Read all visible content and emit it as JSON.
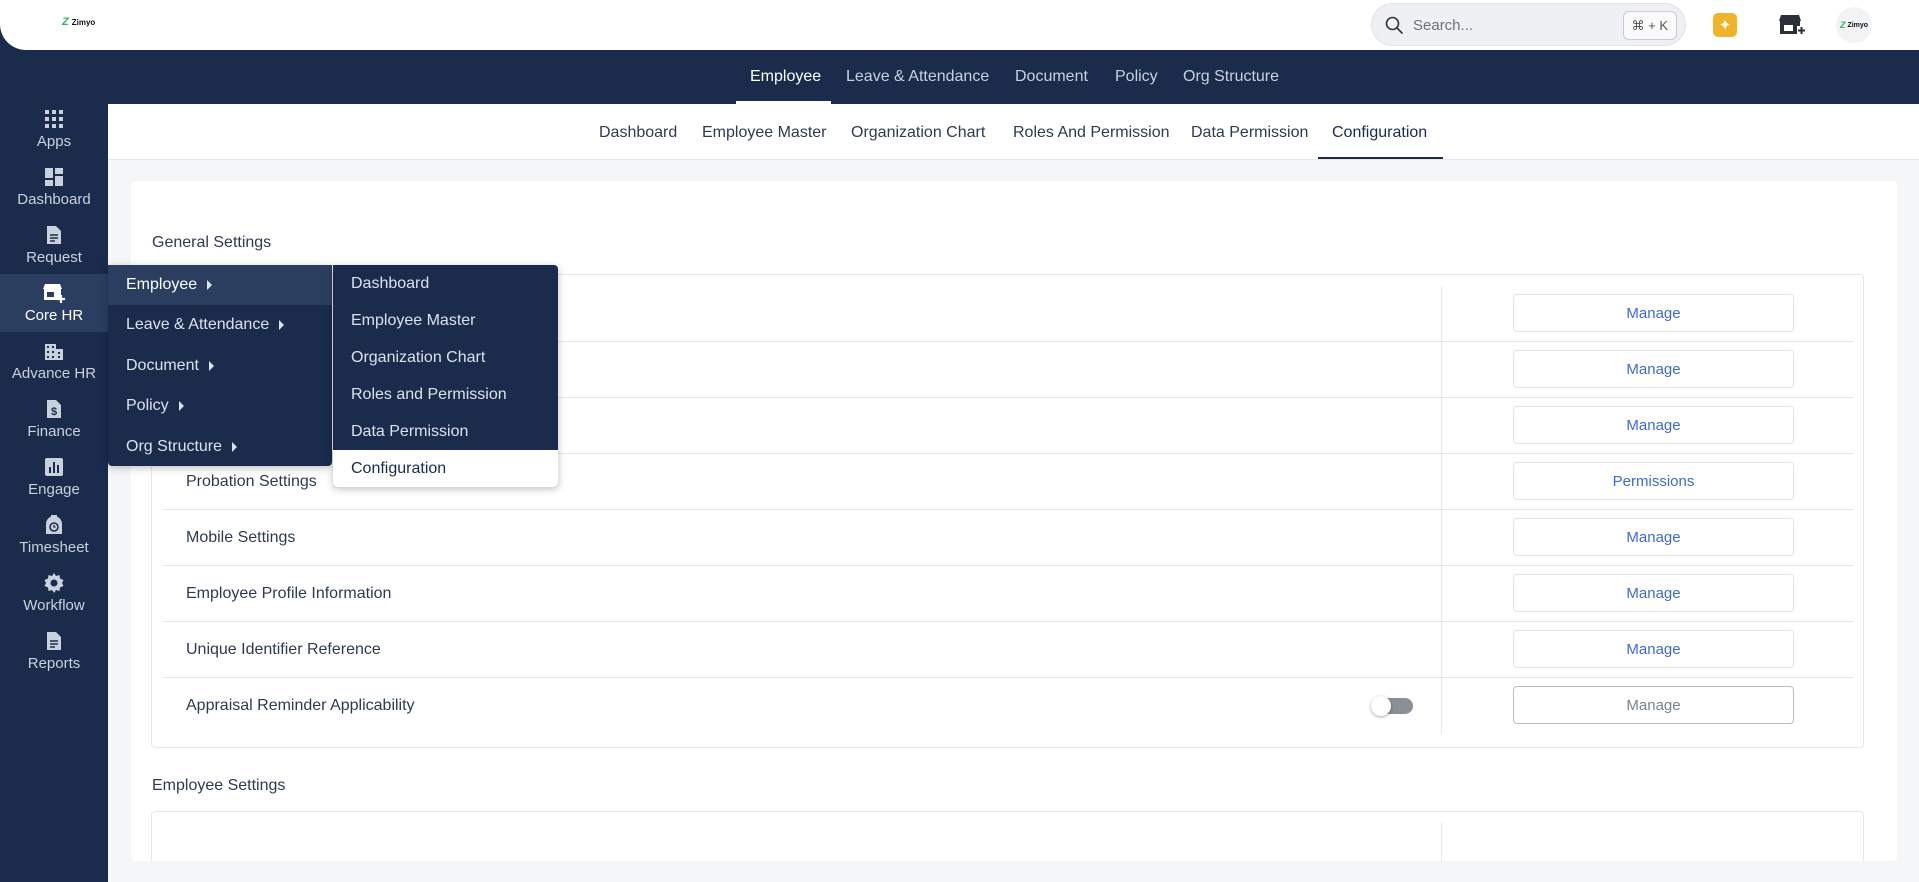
{
  "brand": {
    "logo_mark": "Z",
    "logo_text": "Zimyo"
  },
  "topbar": {
    "search_placeholder": "Search...",
    "search_shortcut": "⌘ + K",
    "icons": [
      "search-icon",
      "sparkle-icon",
      "store-add-icon",
      "avatar"
    ]
  },
  "module_nav": {
    "items": [
      "Employee",
      "Leave & Attendance",
      "Document",
      "Policy",
      "Org Structure"
    ],
    "active": "Employee"
  },
  "sidebar": {
    "items": [
      {
        "label": "Apps",
        "icon": "apps-grid-icon"
      },
      {
        "label": "Dashboard",
        "icon": "dashboard-icon"
      },
      {
        "label": "Request",
        "icon": "document-icon"
      },
      {
        "label": "Core HR",
        "icon": "store-add-icon"
      },
      {
        "label": "Advance HR",
        "icon": "building-icon"
      },
      {
        "label": "Finance",
        "icon": "dollar-doc-icon"
      },
      {
        "label": "Engage",
        "icon": "bar-chart-icon"
      },
      {
        "label": "Timesheet",
        "icon": "timer-icon"
      },
      {
        "label": "Workflow",
        "icon": "gear-icon"
      },
      {
        "label": "Reports",
        "icon": "report-icon"
      }
    ],
    "active": "Core HR"
  },
  "sub_nav": {
    "items": [
      "Dashboard",
      "Employee Master",
      "Organization Chart",
      "Roles And Permission",
      "Data Permission",
      "Configuration"
    ],
    "active": "Configuration"
  },
  "general_settings": {
    "title": "General Settings",
    "rows": [
      {
        "label": "",
        "action": "Manage"
      },
      {
        "label": "",
        "action": "Manage"
      },
      {
        "label": "",
        "action": "Manage"
      },
      {
        "label": "Probation Settings",
        "action": "Permissions"
      },
      {
        "label": "Mobile Settings",
        "action": "Manage"
      },
      {
        "label": "Employee Profile Information",
        "action": "Manage"
      },
      {
        "label": "Unique Identifier Reference",
        "action": "Manage"
      },
      {
        "label": "Appraisal Reminder Applicability",
        "action": "Manage",
        "toggle": "off"
      }
    ]
  },
  "employee_settings": {
    "title": "Employee Settings"
  },
  "flyout_menu": {
    "level1": [
      "Employee",
      "Leave & Attendance",
      "Document",
      "Policy",
      "Org Structure"
    ],
    "level1_active": "Employee",
    "level2": [
      "Dashboard",
      "Employee Master",
      "Organization Chart",
      "Roles and Permission",
      "Data Permission",
      "Configuration"
    ],
    "level2_active": "Configuration"
  },
  "colors": {
    "navy": "#1a2b4c",
    "link_blue": "#3d6ad6",
    "accent_gold": "#f0b429",
    "brand_green": "#35b36b"
  }
}
